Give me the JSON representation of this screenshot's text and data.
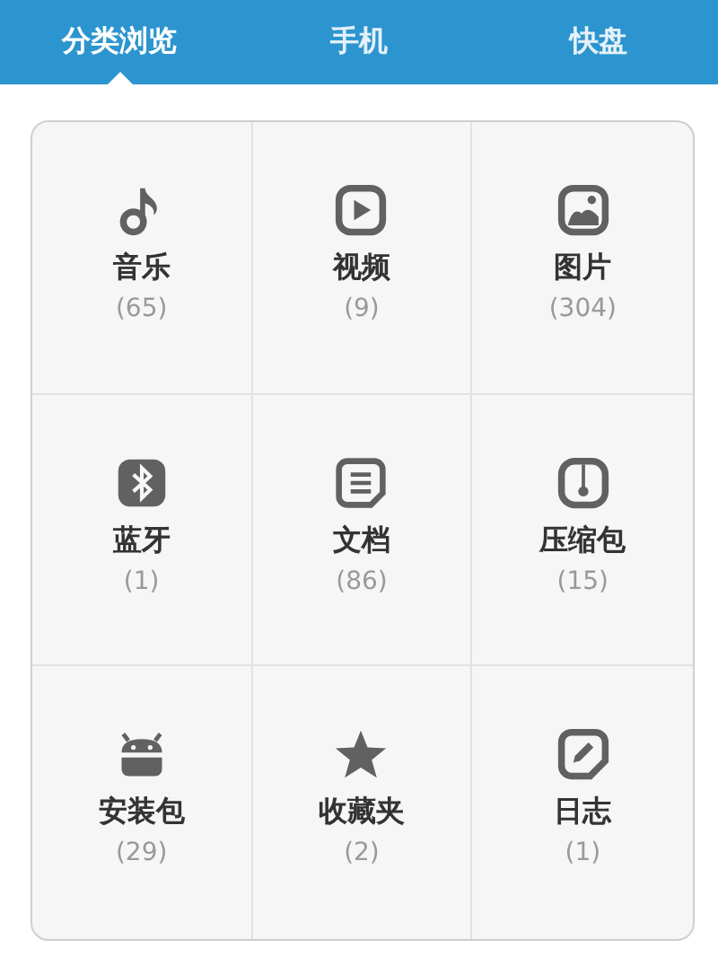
{
  "tabs": [
    {
      "label": "分类浏览",
      "selected": true
    },
    {
      "label": "手机",
      "selected": false
    },
    {
      "label": "快盘",
      "selected": false
    }
  ],
  "categories": [
    {
      "kind": "music",
      "label": "音乐",
      "count": "(65)"
    },
    {
      "kind": "video",
      "label": "视频",
      "count": "(9)"
    },
    {
      "kind": "image",
      "label": "图片",
      "count": "(304)"
    },
    {
      "kind": "bluetooth",
      "label": "蓝牙",
      "count": "(1)"
    },
    {
      "kind": "document",
      "label": "文档",
      "count": "(86)"
    },
    {
      "kind": "archive",
      "label": "压缩包",
      "count": "(15)"
    },
    {
      "kind": "android",
      "label": "安装包",
      "count": "(29)"
    },
    {
      "kind": "star",
      "label": "收藏夹",
      "count": "(2)"
    },
    {
      "kind": "log",
      "label": "日志",
      "count": "(1)"
    }
  ]
}
